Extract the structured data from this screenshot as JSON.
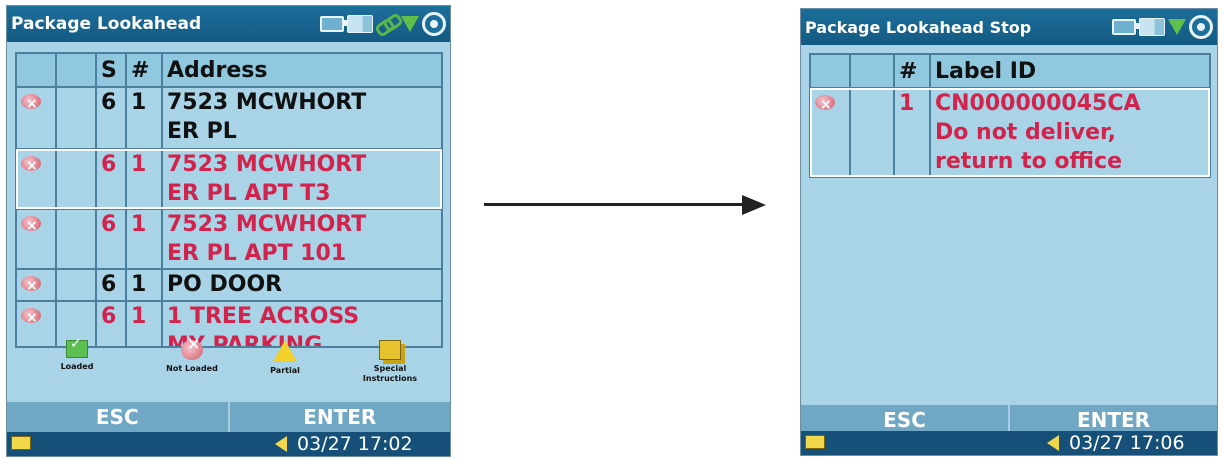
{
  "left_screen": {
    "title": "Package Lookahead",
    "columns": [
      "",
      "",
      "S",
      "#",
      "Address"
    ],
    "rows": [
      {
        "s": "6",
        "n": "1",
        "address_line1": "7523 MCWHORT",
        "address_line2": "ER PL",
        "color": "#111111"
      },
      {
        "s": "6",
        "n": "1",
        "address_line1": "7523 MCWHORT",
        "address_line2": "ER PL APT T3",
        "color": "#d2234d"
      },
      {
        "s": "6",
        "n": "1",
        "address_line1": "7523 MCWHORT",
        "address_line2": "ER PL APT 101",
        "color": "#d2234d"
      },
      {
        "s": "6",
        "n": "1",
        "address_line1": "PO DOOR",
        "address_line2": "",
        "color": "#111111"
      },
      {
        "s": "6",
        "n": "1",
        "address_line1": "1 TREE ACROSS",
        "address_line2": "MY PARKING",
        "color": "#d2234d"
      }
    ],
    "legend": {
      "loaded": "Loaded",
      "not_loaded": "Not Loaded",
      "partial": "Partial",
      "special_line1": "Special",
      "special_line2": "Instructions"
    },
    "softkeys": {
      "esc": "ESC",
      "enter": "ENTER"
    },
    "clock": "03/27 17:02"
  },
  "right_screen": {
    "title": "Package Lookahead Stop",
    "columns": [
      "",
      "",
      "#",
      "Label ID"
    ],
    "row": {
      "n": "1",
      "line1": "CN000000045CA",
      "line2": "Do not deliver,",
      "line3": "return to office"
    },
    "softkeys": {
      "esc": "ESC",
      "enter": "ENTER"
    },
    "clock": "03/27 17:06"
  },
  "colors": {
    "screen_bg": "#a9d3e6",
    "titlebar": "#1d6e9a",
    "highlight_red": "#d2234d",
    "bottombar": "#164f77"
  }
}
